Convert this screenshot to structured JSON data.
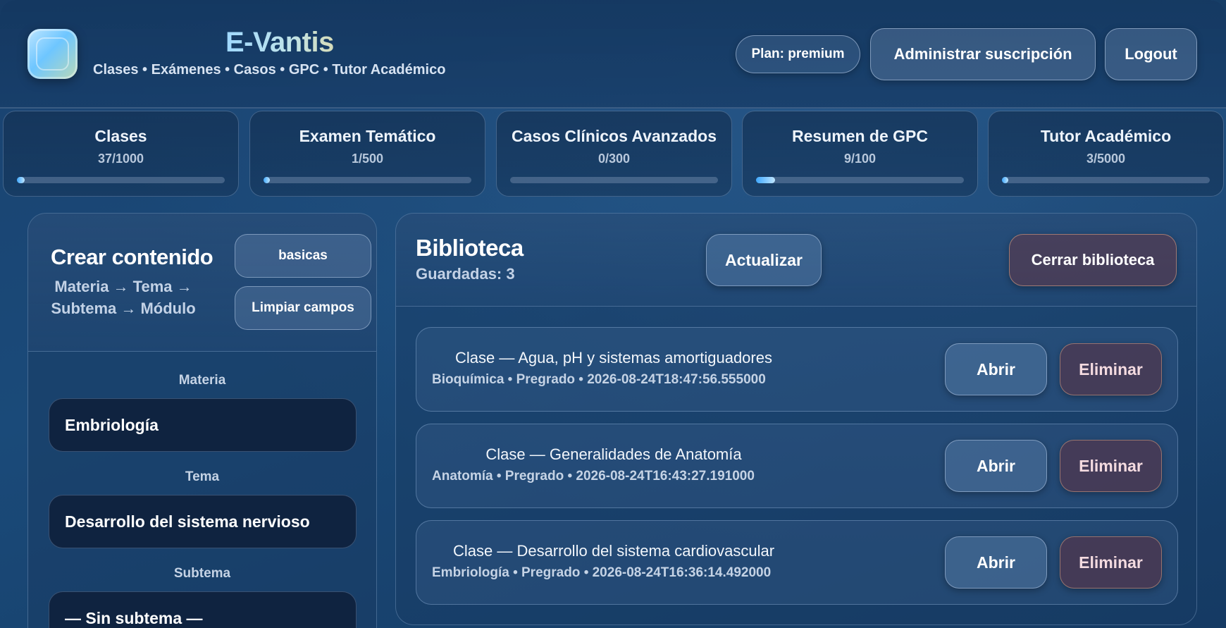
{
  "header": {
    "title": "E-Vantis",
    "subtitle": "Clases • Exámenes • Casos • GPC • Tutor Académico",
    "plan_label": "Plan: premium",
    "manage_label": "Administrar suscripción",
    "logout_label": "Logout"
  },
  "stats": [
    {
      "title": "Clases",
      "count": "37/1000",
      "progress": 0.037
    },
    {
      "title": "Examen Temático",
      "count": "1/500",
      "progress": 0.002
    },
    {
      "title": "Casos Clínicos Avanzados",
      "count": "0/300",
      "progress": 0.0
    },
    {
      "title": "Resumen de GPC",
      "count": "9/100",
      "progress": 0.09
    },
    {
      "title": "Tutor Académico",
      "count": "3/5000",
      "progress": 0.0006
    }
  ],
  "create": {
    "title": "Crear contenido",
    "path": "Materia → Tema → Subtema → Módulo",
    "level_button": "basicas",
    "clear_button": "Limpiar campos",
    "materia_label": "Materia",
    "materia_value": "Embriología",
    "tema_label": "Tema",
    "tema_value": "Desarrollo del sistema nervioso",
    "subtema_label": "Subtema",
    "subtema_value": "— Sin subtema —"
  },
  "library": {
    "title": "Biblioteca",
    "saved": "Guardadas: 3",
    "update_label": "Actualizar",
    "close_label": "Cerrar biblioteca",
    "items": [
      {
        "title": "Clase — Agua, pH y sistemas amortiguadores",
        "meta": "Bioquímica • Pregrado • 2026-08-24T18:47:56.555000",
        "open": "Abrir",
        "delete": "Eliminar"
      },
      {
        "title": "Clase — Generalidades de Anatomía",
        "meta": "Anatomía • Pregrado • 2026-08-24T16:43:27.191000",
        "open": "Abrir",
        "delete": "Eliminar"
      },
      {
        "title": "Clase — Desarrollo del sistema cardiovascular",
        "meta": "Embriología • Pregrado • 2026-08-24T16:36:14.492000",
        "open": "Abrir",
        "delete": "Eliminar"
      }
    ]
  }
}
